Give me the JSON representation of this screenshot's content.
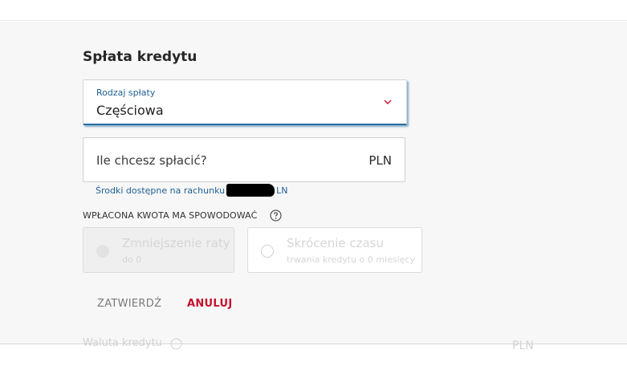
{
  "repayment": {
    "title": "Spłata kredytu",
    "type_select": {
      "label": "Rodzaj spłaty",
      "value": "Częściowa",
      "icon": "chevron-down-icon"
    },
    "amount_field": {
      "placeholder": "Ile chcesz spłacić?",
      "currency": "PLN"
    },
    "available_text": "Środki dostępne na rachunku",
    "available_suffix": "LN",
    "effect": {
      "label": "WPŁACONA KWOTA MA SPOWODOWAĆ",
      "help_icon": "question-circle-icon",
      "options": [
        {
          "title": "Zmniejszenie raty",
          "subtitle": "do 0",
          "state": "disabled-selected"
        },
        {
          "title": "Skrócenie czasu",
          "subtitle": "trwania kredytu o 0 miesięcy",
          "state": "disabled"
        }
      ]
    },
    "actions": {
      "confirm": "ZATWIERDŹ",
      "cancel": "ANULUJ"
    }
  },
  "below": {
    "label": "Waluta kredytu",
    "currency": "PLN"
  },
  "colors": {
    "accent": "#2a6fa3",
    "danger": "#c8102e",
    "panel_bg": "#f7f7f7"
  }
}
